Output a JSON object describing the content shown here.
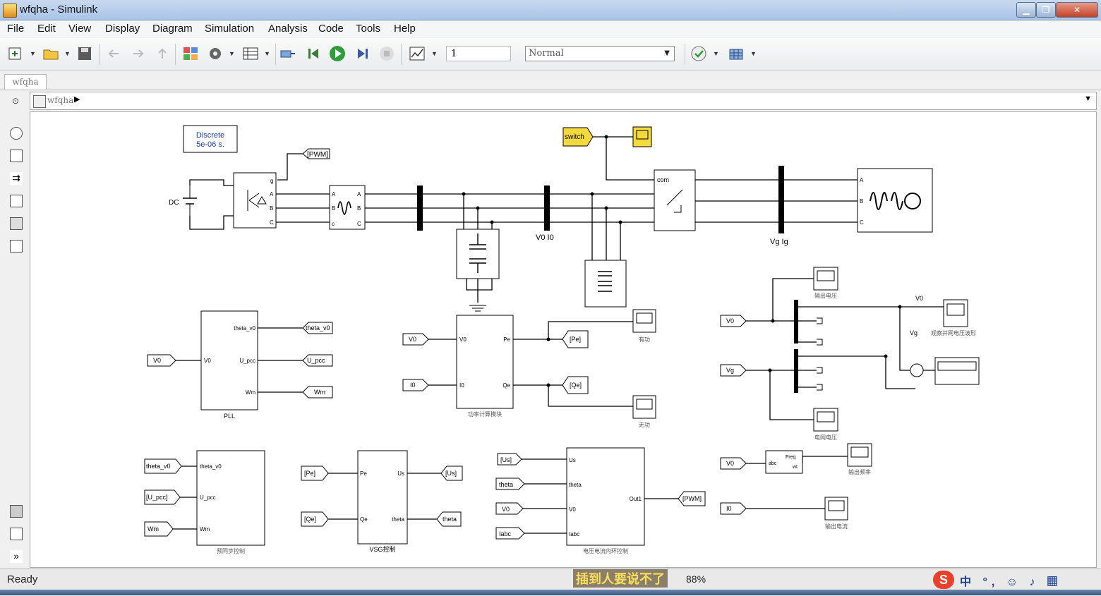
{
  "window": {
    "title": "wfqha - Simulink",
    "btn_min": "▁",
    "btn_max": "❐",
    "btn_close": "✕"
  },
  "menu": [
    "File",
    "Edit",
    "View",
    "Display",
    "Diagram",
    "Simulation",
    "Analysis",
    "Code",
    "Tools",
    "Help"
  ],
  "toolbar": {
    "stop_time": "1",
    "sim_mode": "Normal"
  },
  "tab": {
    "label": "wfqha"
  },
  "breadcrumb": {
    "model": "wfqha"
  },
  "diagram": {
    "powergui": [
      "Discrete",
      "5e-06 s."
    ],
    "switch_const": "switch",
    "dc_label": "DC",
    "pwm_tag": "[PWM]",
    "v0_i0_label": "V0  I0",
    "vg_ig_label": "Vg  Ig",
    "ports_bridge": [
      "g",
      "A",
      "B",
      "C"
    ],
    "ports_abc": [
      "A",
      "B",
      "C"
    ],
    "ports_abc_lower": [
      "a",
      "b",
      "c"
    ],
    "breaker_com": "com",
    "pll": {
      "input": "V0",
      "in_port": "V0",
      "out_ports": [
        "theta_v0",
        "U_pcc",
        "Wm"
      ],
      "outputs": [
        "theta_v0",
        "U_pcc",
        "Wm"
      ],
      "name": "PLL"
    },
    "power_calc": {
      "inputs": [
        "V0",
        "I0"
      ],
      "in_ports": [
        "V0",
        "I0"
      ],
      "out_ports": [
        "Pe",
        "Qe"
      ],
      "outputs": [
        "[Pe]",
        "[Qe]"
      ],
      "name": "功率计算模块",
      "scope_p": "有功",
      "scope_q": "无功"
    },
    "scopes_right": {
      "inputs": [
        "V0",
        "Vg"
      ],
      "v0_wire": "V0",
      "vg_wire": "Vg",
      "scope_out_voltage": "输出电压",
      "scope_grid_compare": "观察并网电压波形",
      "scope_grid_voltage": "电网电压"
    },
    "freq": {
      "input": "V0",
      "port_in": "abc",
      "port_out": "Freq",
      "port_out2": "wt",
      "scope": "输出频率"
    },
    "current_scope": {
      "input": "I0",
      "scope": "输出电流"
    },
    "presync": {
      "inputs": [
        "theta_v0",
        "[U_pcc]",
        "Wm"
      ],
      "in_ports": [
        "theta_v0",
        "U_pcc",
        "Wm"
      ],
      "name": "预同步控制"
    },
    "vsg": {
      "inputs": [
        "[Pe]",
        "[Qe]"
      ],
      "in_ports": [
        "Pe",
        "Qe"
      ],
      "out_ports": [
        "Us",
        "theta"
      ],
      "outputs": [
        "[Us]",
        "theta"
      ],
      "name": "VSG控制"
    },
    "loop_ctrl": {
      "inputs": [
        "[Us]",
        "theta",
        "V0",
        "Iabc"
      ],
      "in_ports": [
        "Us",
        "theta",
        "V0",
        "Iabc"
      ],
      "out_port": "Out1",
      "output": "[PWM]",
      "name": "电压电流内环控制"
    }
  },
  "status": {
    "ready": "Ready",
    "zoom": "88%",
    "caption": "插到人要说不了"
  },
  "ime": {
    "logo": "S",
    "text": "中 °, ☺ ♪ ▦"
  }
}
